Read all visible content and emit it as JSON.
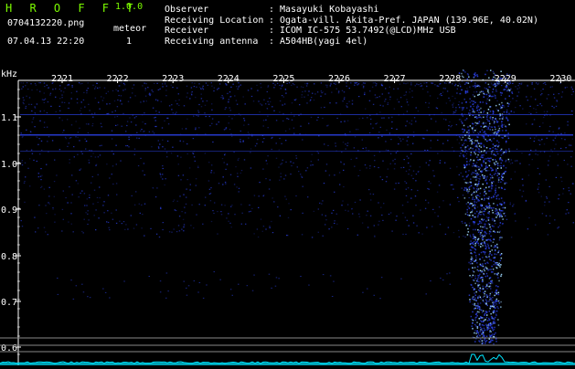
{
  "app": {
    "title": "H R O F F T",
    "version": "1.0.0"
  },
  "file": {
    "name": "0704132220.png",
    "datetime": "07.04.13 22:20"
  },
  "event": {
    "label": "meteor",
    "count": "1"
  },
  "info": [
    {
      "key": "Observer",
      "sep": ":",
      "value": "Masayuki Kobayashi"
    },
    {
      "key": "Receiving Location",
      "sep": ":",
      "value": "Ogata-vill. Akita-Pref. JAPAN (139.96E, 40.02N)"
    },
    {
      "key": "Receiver",
      "sep": ":",
      "value": "ICOM IC-575 53.7492(@LCD)MHz USB"
    },
    {
      "key": "Receiving antenna",
      "sep": ":",
      "value": "A504HB(yagi 4el)"
    }
  ],
  "plot": {
    "y_unit": "kHz",
    "time_ticks": [
      "2221",
      "2222",
      "2223",
      "2224",
      "2225",
      "2226",
      "2227",
      "2228",
      "2229",
      "2230"
    ],
    "freq_ticks": [
      "1.1",
      "1.0",
      "0.9",
      "0.8",
      "0.7",
      "0.6"
    ],
    "colors": {
      "axis": "#ffffff",
      "tick_text": "#ffffff",
      "noise": "#2a3fe0",
      "echo": "#9fd8ff",
      "baseline": "#888888",
      "trace": "#00e5ff"
    }
  }
}
